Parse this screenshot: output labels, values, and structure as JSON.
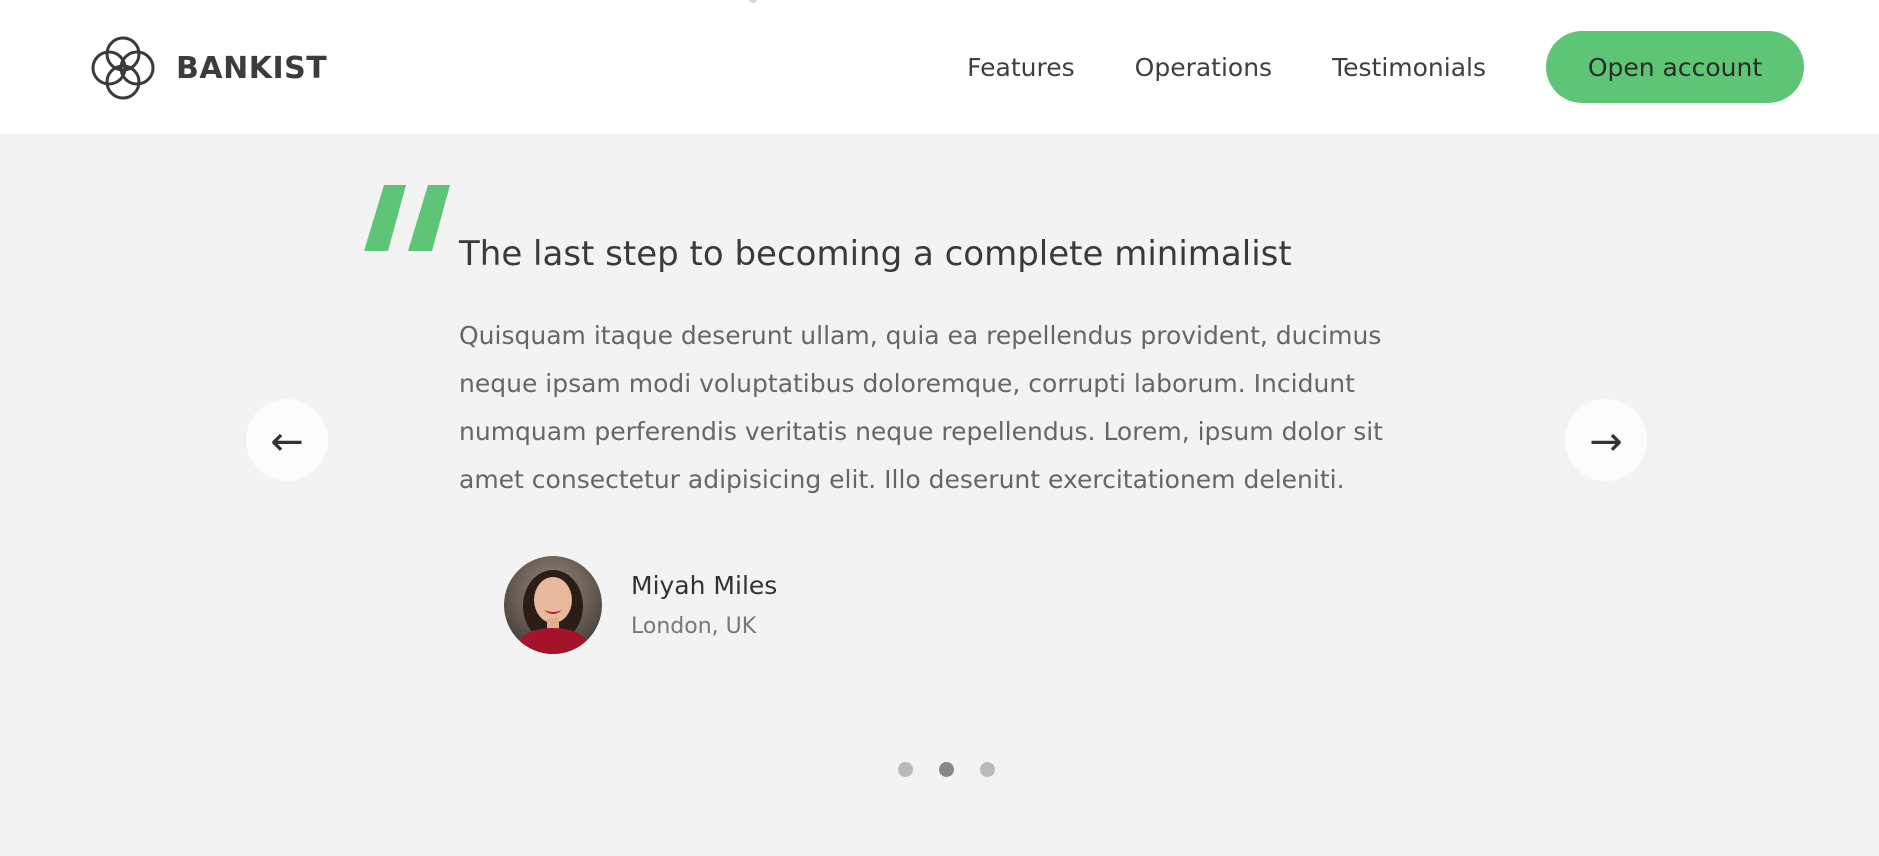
{
  "header": {
    "logo_text": "BANKIST",
    "nav_links": [
      "Features",
      "Operations",
      "Testimonials"
    ],
    "cta_label": "Open account"
  },
  "testimonial": {
    "headline": "The last step to becoming a complete minimalist",
    "body": "Quisquam itaque deserunt ullam, quia ea repellendus provident, ducimus neque ipsam modi voluptatibus doloremque, corrupti laborum. Incidunt numquam perferendis veritatis neque repellendus. Lorem, ipsum dolor sit amet consectetur adipisicing elit. Illo deserunt exercitationem deleniti.",
    "author_name": "Miyah Miles",
    "author_location": "London, UK"
  },
  "slider": {
    "prev_icon": "←",
    "next_icon": "→",
    "dots_count": 3,
    "active_dot": 1
  },
  "colors": {
    "accent": "#5ec576",
    "background": "#f3f3f3",
    "header_bg": "#ffffff"
  },
  "icons": {
    "logo": "four-circles-logo-icon",
    "quote": "quote-mark-icon",
    "prev": "arrow-left-icon",
    "next": "arrow-right-icon"
  }
}
